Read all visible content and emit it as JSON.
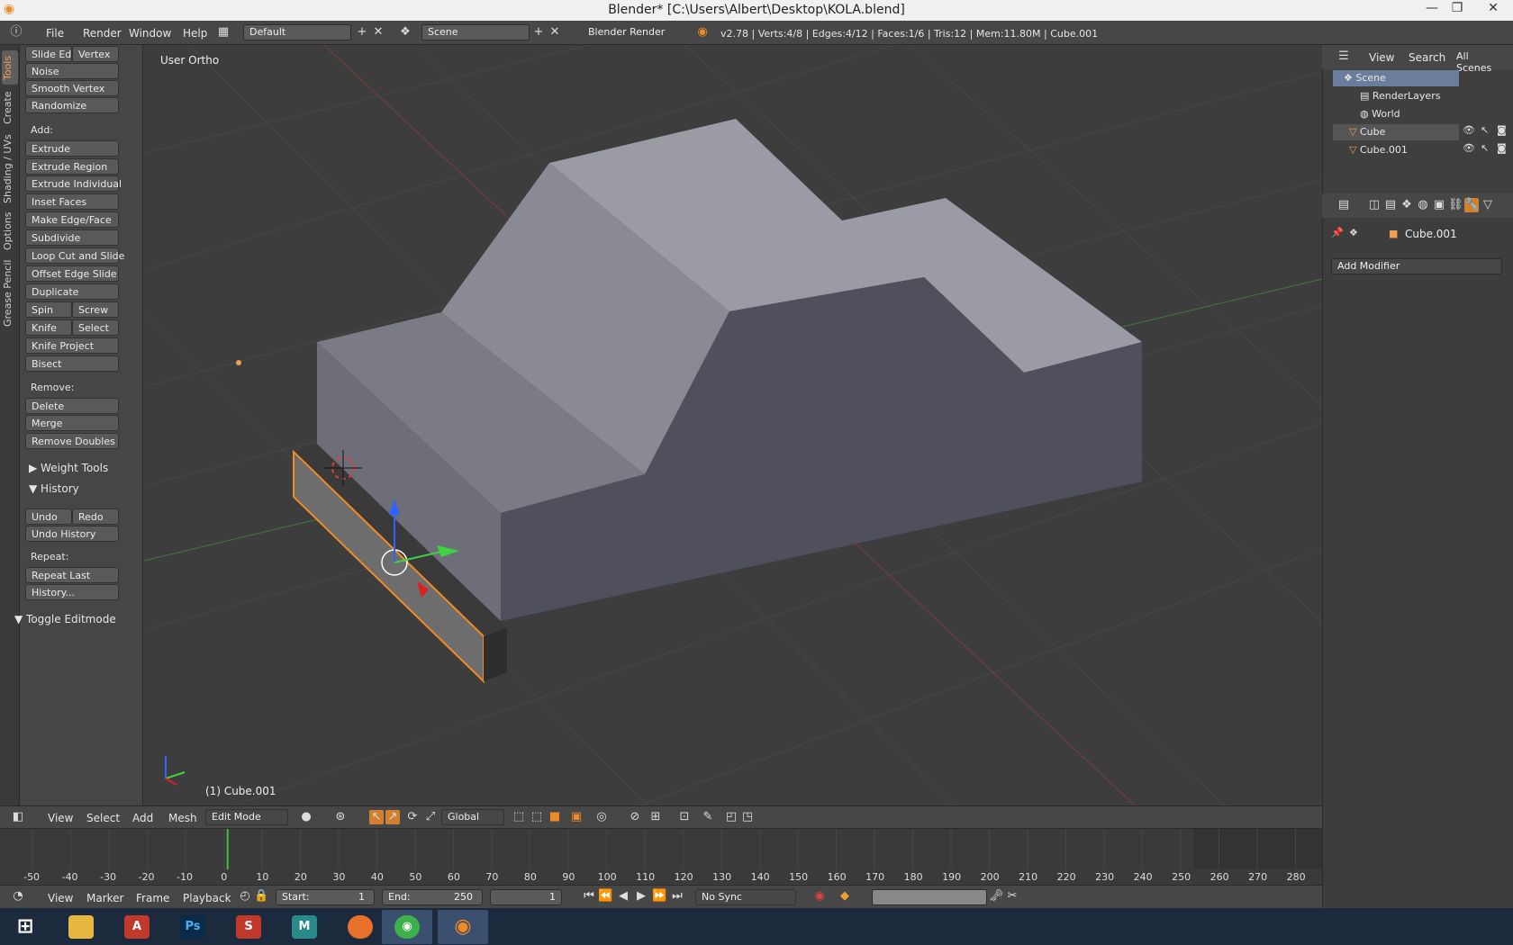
{
  "title": "Blender* [C:\\Users\\Albert\\Desktop\\KOLA.blend]",
  "info_header": {
    "menus": [
      "File",
      "Render",
      "Window",
      "Help"
    ],
    "layout": "Default",
    "scene": "Scene",
    "engine": "Blender Render",
    "stats": "v2.78 | Verts:4/8 | Edges:4/12 | Faces:1/6 | Tris:12 | Mem:11.80M | Cube.001"
  },
  "tool_tabs": [
    "Tools",
    "Create",
    "Shading / UVs",
    "Options",
    "Grease Pencil"
  ],
  "tools": {
    "row1": [
      "Slide Ed",
      "Vertex"
    ],
    "top": [
      "Noise",
      "Smooth Vertex",
      "Randomize"
    ],
    "add_label": "Add:",
    "add": [
      "Extrude",
      "Extrude Region",
      "Extrude Individual",
      "Inset Faces",
      "Make Edge/Face",
      "Subdivide",
      "Loop Cut and Slide",
      "Offset Edge Slide",
      "Duplicate"
    ],
    "spin_row": [
      "Spin",
      "Screw"
    ],
    "knife_row": [
      "Knife",
      "Select"
    ],
    "after": [
      "Knife Project",
      "Bisect"
    ],
    "remove_label": "Remove:",
    "remove": [
      "Delete",
      "Merge",
      "Remove Doubles"
    ],
    "weight_tools": "Weight Tools",
    "history": "History",
    "undo_row": [
      "Undo",
      "Redo"
    ],
    "undo_history": "Undo History",
    "repeat_label": "Repeat:",
    "repeat": [
      "Repeat Last",
      "History..."
    ],
    "toggle_editmode": "Toggle Editmode"
  },
  "viewport": {
    "label": "User Ortho",
    "object": "(1) Cube.001"
  },
  "view3d_header": {
    "menus": [
      "View",
      "Select",
      "Add",
      "Mesh"
    ],
    "mode": "Edit Mode",
    "orientation": "Global"
  },
  "timeline": {
    "ticks": [
      "-50",
      "-40",
      "-30",
      "-20",
      "-10",
      "0",
      "10",
      "20",
      "30",
      "40",
      "50",
      "60",
      "70",
      "80",
      "90",
      "100",
      "110",
      "120",
      "130",
      "140",
      "150",
      "160",
      "170",
      "180",
      "190",
      "200",
      "210",
      "220",
      "230",
      "240",
      "250",
      "260",
      "270",
      "280"
    ],
    "current_frame": 1,
    "menus": [
      "View",
      "Marker",
      "Frame",
      "Playback"
    ],
    "start_label": "Start:",
    "start": "1",
    "end_label": "End:",
    "end": "250",
    "frame": "1",
    "sync": "No Sync"
  },
  "outliner": {
    "menus": [
      "View",
      "Search",
      "All Scenes"
    ],
    "items": [
      "Scene",
      "RenderLayers",
      "World",
      "Cube",
      "Cube.001"
    ]
  },
  "properties": {
    "object": "Cube.001",
    "add_modifier": "Add Modifier"
  },
  "taskbar": {
    "apps": [
      "windows",
      "explorer",
      "acrobat",
      "photoshop",
      "sketchup",
      "maya",
      "firefox",
      "chrome",
      "blender"
    ],
    "active": "blender"
  },
  "colors": {
    "selection_orange": "#f08a24",
    "accent_blue": "#6b7d9c",
    "mesh_face": "#8a8a9a"
  }
}
